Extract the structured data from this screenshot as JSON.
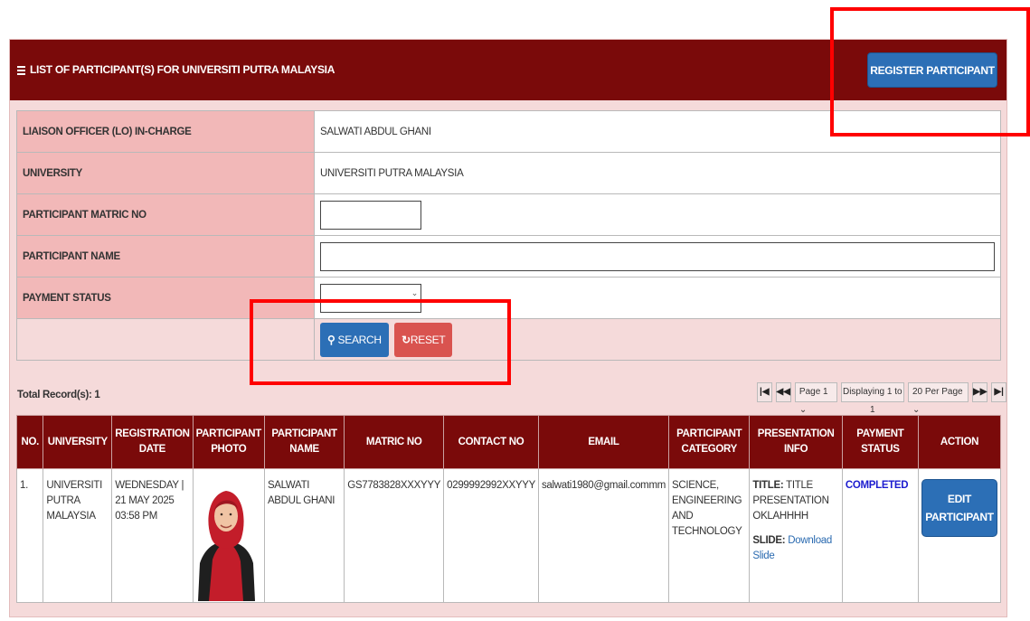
{
  "panel": {
    "title": "LIST OF PARTICIPANT(S) FOR UNIVERSITI PUTRA MALAYSIA",
    "register_label": "REGISTER PARTICIPANT"
  },
  "form": {
    "lo_label": "LIAISON OFFICER (LO) IN-CHARGE",
    "lo_value": "SALWATI ABDUL GHANI",
    "university_label": "UNIVERSITY",
    "university_value": "UNIVERSITI PUTRA MALAYSIA",
    "matric_label": "PARTICIPANT MATRIC NO",
    "matric_value": "",
    "name_label": "PARTICIPANT NAME",
    "name_value": "",
    "payment_label": "PAYMENT STATUS",
    "payment_value": "",
    "search_label": "SEARCH",
    "reset_label": "RESET"
  },
  "total_records": "Total Record(s): 1",
  "pager": {
    "page": "Page 1",
    "display": "Displaying 1 to 1",
    "per_page": "20 Per Page"
  },
  "columns": [
    "NO.",
    "UNIVERSITY",
    "REGISTRATION DATE",
    "PARTICIPANT PHOTO",
    "PARTICIPANT NAME",
    "MATRIC NO",
    "CONTACT NO",
    "EMAIL",
    "PARTICIPANT CATEGORY",
    "PRESENTATION INFO",
    "PAYMENT STATUS",
    "ACTION"
  ],
  "rows": [
    {
      "no": "1.",
      "university": "UNIVERSITI PUTRA MALAYSIA",
      "reg_date": "WEDNESDAY | 21 MAY 2025 03:58 PM",
      "name": "SALWATI ABDUL GHANI",
      "matric": "GS7783828XXXYYY",
      "contact": "0299992992XXYYY",
      "email": "salwati1980@gmail.commm",
      "category": "SCIENCE, ENGINEERING AND TECHNOLOGY",
      "title_label": "TITLE:",
      "title_value": "TITLE PRESENTATION OKLAHHHH",
      "slide_label": "SLIDE:",
      "slide_link": "Download Slide",
      "payment_status": "COMPLETED",
      "action_label": "EDIT PARTICIPANT"
    }
  ],
  "colors": {
    "header_bg": "#7a0a0a",
    "label_bg": "#f2b8b8",
    "primary_btn": "#2c6fb6",
    "reset_btn": "#d9534f",
    "highlight": "#ff0000",
    "completed_text": "#1c1ccf"
  }
}
